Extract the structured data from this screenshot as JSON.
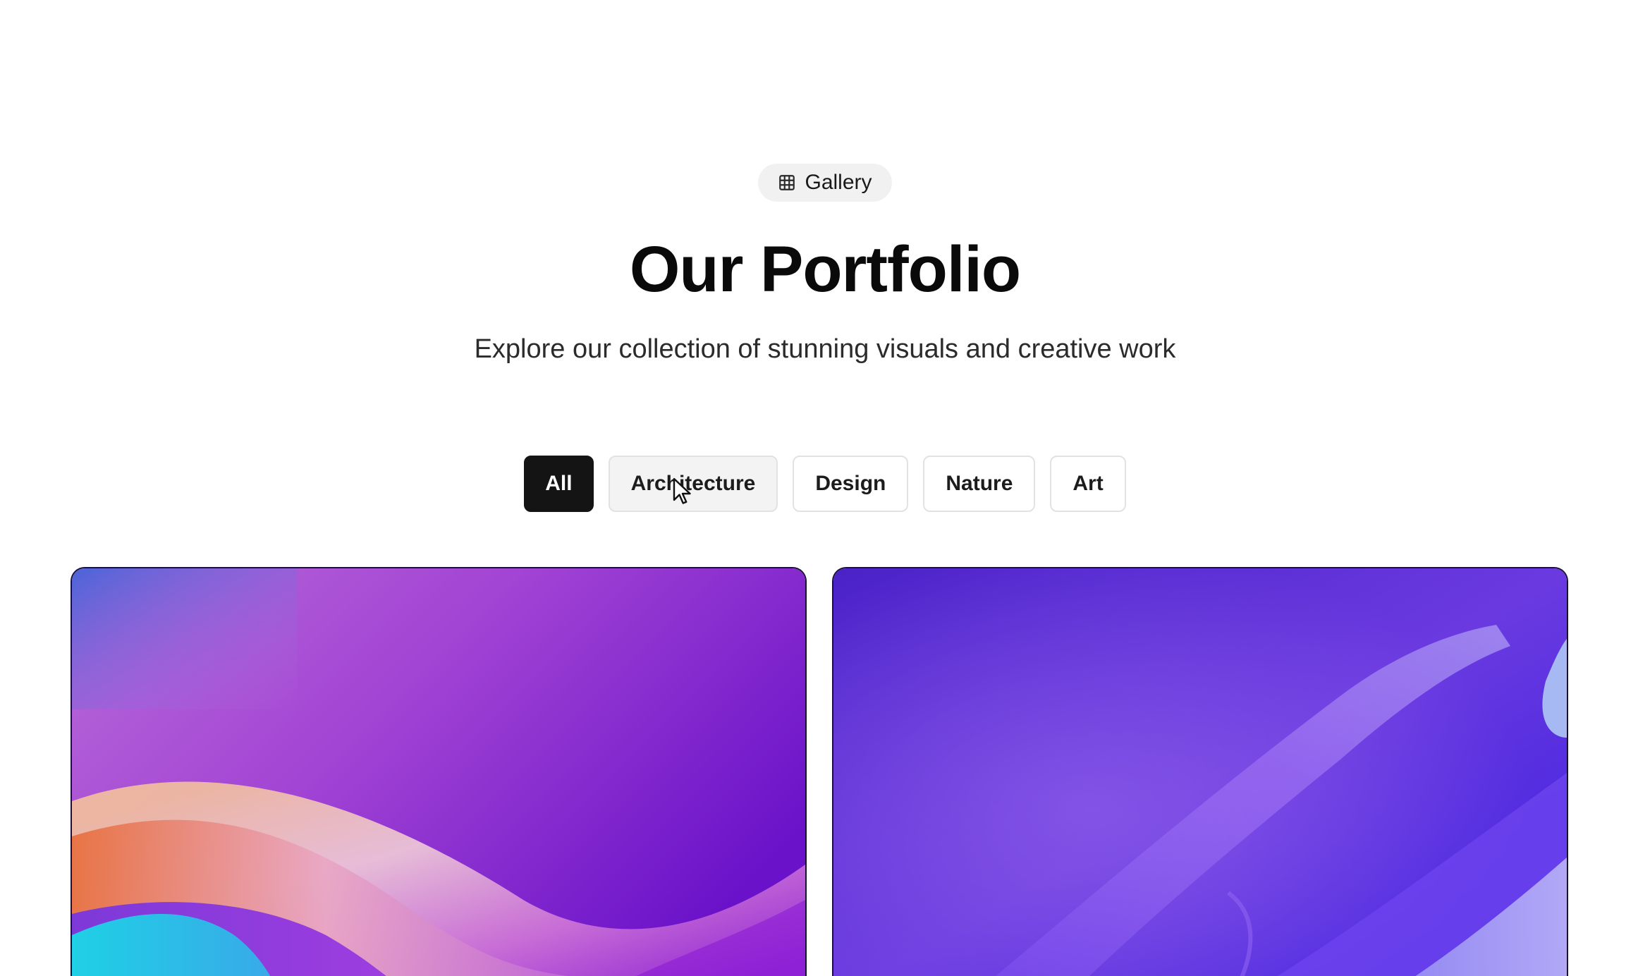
{
  "badge": {
    "icon": "grid-icon",
    "label": "Gallery"
  },
  "title": "Our Portfolio",
  "subtitle": "Explore our collection of stunning visuals and creative work",
  "filters": [
    {
      "label": "All",
      "state": "active"
    },
    {
      "label": "Architecture",
      "state": "hover"
    },
    {
      "label": "Design",
      "state": "default"
    },
    {
      "label": "Nature",
      "state": "default"
    },
    {
      "label": "Art",
      "state": "default"
    }
  ],
  "gallery": {
    "items": [
      {
        "name": "gallery-image-1",
        "palette": [
          "#7a2fd6",
          "#c35ad8",
          "#f5b89a",
          "#2ec6e0"
        ]
      },
      {
        "name": "gallery-image-2",
        "palette": [
          "#4a22d8",
          "#6b35e6",
          "#8d5cf0",
          "#b9b4f5"
        ]
      }
    ]
  },
  "colors": {
    "accent": "#141414",
    "badge_bg": "#f1f1f2",
    "border": "#e2e2e4"
  }
}
